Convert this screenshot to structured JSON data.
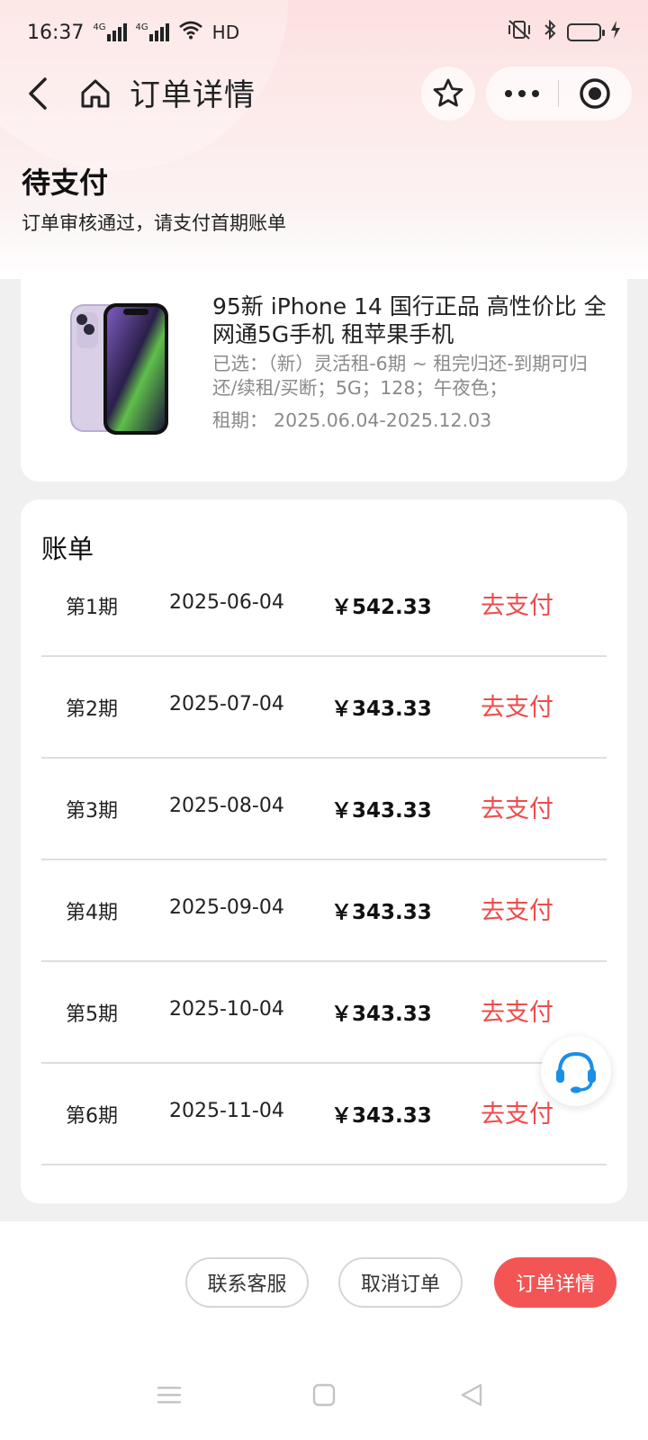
{
  "status_bar": {
    "time": "16:37",
    "net1": "4G",
    "net2": "4G",
    "hd": "HD"
  },
  "nav": {
    "title": "订单详情"
  },
  "order": {
    "status": "待支付",
    "substatus": "订单审核通过，请支付首期账单"
  },
  "product": {
    "title": "95新 iPhone 14 国行正品 高性价比 全网通5G手机 租苹果手机",
    "spec_label": "已选：",
    "spec": "（新）灵活租-6期 ~ 租完归还-到期可归还/续租/买断；5G；128；午夜色；",
    "period_label": "租期：",
    "period": "2025.06.04-2025.12.03"
  },
  "bill": {
    "heading": "账单",
    "currency": "￥",
    "pay_label": "去支付",
    "rows": [
      {
        "period": "第1期",
        "date": "2025-06-04",
        "amount": "542.33"
      },
      {
        "period": "第2期",
        "date": "2025-07-04",
        "amount": "343.33"
      },
      {
        "period": "第3期",
        "date": "2025-08-04",
        "amount": "343.33"
      },
      {
        "period": "第4期",
        "date": "2025-09-04",
        "amount": "343.33"
      },
      {
        "period": "第5期",
        "date": "2025-10-04",
        "amount": "343.33"
      },
      {
        "period": "第6期",
        "date": "2025-11-04",
        "amount": "343.33"
      }
    ]
  },
  "actions": {
    "contact": "联系客服",
    "cancel": "取消订单",
    "detail": "订单详情"
  },
  "colors": {
    "accent": "#f35555",
    "pay_text": "#ee4b4b",
    "service_icon": "#1a8fe8"
  },
  "icons": [
    "back-icon",
    "home-icon",
    "star-icon",
    "more-icon",
    "close-circle-icon",
    "headset-icon",
    "menu-icon",
    "square-icon",
    "triangle-back-icon"
  ]
}
